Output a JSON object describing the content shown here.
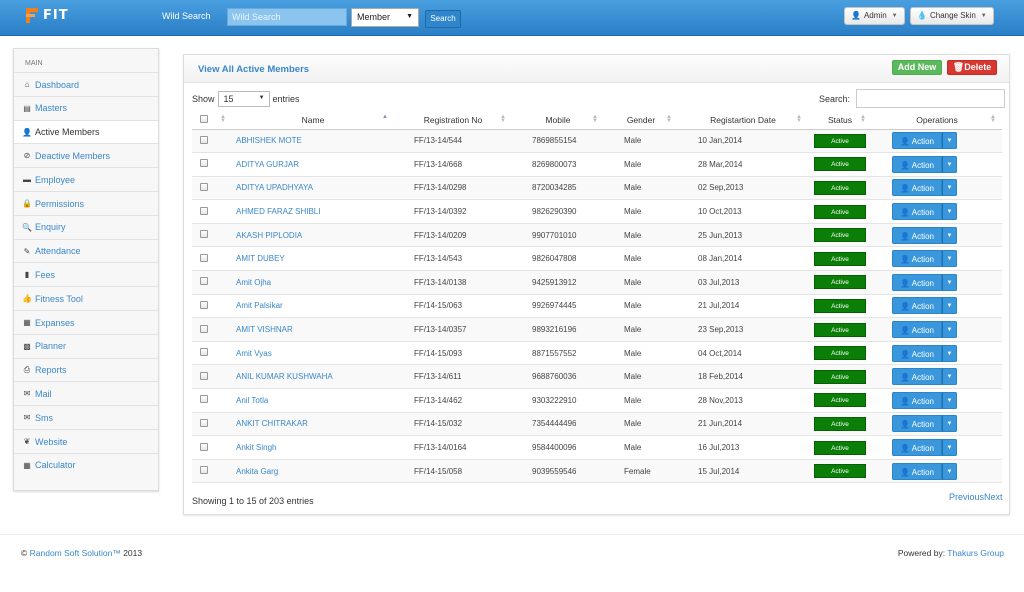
{
  "app": {
    "logo_text": "FIT"
  },
  "header": {
    "wild_search_label": "Wild Search",
    "wild_search_placeholder": "Wild Search",
    "member_select": "Member",
    "search_button": "Search",
    "admin_button": "Admin",
    "skin_button": "Change Skin"
  },
  "sidebar": {
    "section_label": "MAIN",
    "items": [
      {
        "label": "Dashboard",
        "icon": "home-icon",
        "glyph": "⌂"
      },
      {
        "label": "Masters",
        "icon": "list-icon",
        "glyph": "▤"
      },
      {
        "label": "Active Members",
        "icon": "user-icon",
        "glyph": "👤"
      },
      {
        "label": "Deactive Members",
        "icon": "user-ban-icon",
        "glyph": "⊘"
      },
      {
        "label": "Employee",
        "icon": "briefcase-icon",
        "glyph": "▬"
      },
      {
        "label": "Permissions",
        "icon": "lock-icon",
        "glyph": "🔒"
      },
      {
        "label": "Enquiry",
        "icon": "search-icon",
        "glyph": "🔍"
      },
      {
        "label": "Attendance",
        "icon": "tag-icon",
        "glyph": "✎"
      },
      {
        "label": "Fees",
        "icon": "file-icon",
        "glyph": "▮"
      },
      {
        "label": "Fitness Tool",
        "icon": "thumbs-up-icon",
        "glyph": "👍"
      },
      {
        "label": "Expanses",
        "icon": "grid-icon",
        "glyph": "▦"
      },
      {
        "label": "Planner",
        "icon": "calendar-icon",
        "glyph": "▩"
      },
      {
        "label": "Reports",
        "icon": "print-icon",
        "glyph": "⎙"
      },
      {
        "label": "Mail",
        "icon": "envelope-icon",
        "glyph": "✉"
      },
      {
        "label": "Sms",
        "icon": "envelope-icon",
        "glyph": "✉"
      },
      {
        "label": "Website",
        "icon": "leaf-icon",
        "glyph": "❦"
      },
      {
        "label": "Calculator",
        "icon": "calculator-icon",
        "glyph": "▦"
      }
    ]
  },
  "panel": {
    "title": "View All Active Members",
    "add_button": "Add New",
    "delete_button": "Delete",
    "show_label": "Show",
    "page_length": "15",
    "entries_label": "entries",
    "search_label": "Search:",
    "columns": [
      "Name",
      "Registration No",
      "Mobile",
      "Gender",
      "Registartion Date",
      "Status",
      "Operations"
    ],
    "rows": [
      {
        "name": "ABHISHEK MOTE",
        "reg": "FF/13-14/544",
        "mobile": "7869855154",
        "gender": "Male",
        "date": "10 Jan,2014",
        "status": "Active",
        "action": "Action"
      },
      {
        "name": "ADITYA GURJAR",
        "reg": "FF/13-14/668",
        "mobile": "8269800073",
        "gender": "Male",
        "date": "28 Mar,2014",
        "status": "Active",
        "action": "Action"
      },
      {
        "name": "ADITYA UPADHYAYA",
        "reg": "FF/13-14/0298",
        "mobile": "8720034285",
        "gender": "Male",
        "date": "02 Sep,2013",
        "status": "Active",
        "action": "Action"
      },
      {
        "name": "AHMED FARAZ SHIBLI",
        "reg": "FF/13-14/0392",
        "mobile": "9826290390",
        "gender": "Male",
        "date": "10 Oct,2013",
        "status": "Active",
        "action": "Action"
      },
      {
        "name": "AKASH PIPLODIA",
        "reg": "FF/13-14/0209",
        "mobile": "9907701010",
        "gender": "Male",
        "date": "25 Jun,2013",
        "status": "Active",
        "action": "Action"
      },
      {
        "name": "AMIT DUBEY",
        "reg": "FF/13-14/543",
        "mobile": "9826047808",
        "gender": "Male",
        "date": "08 Jan,2014",
        "status": "Active",
        "action": "Action"
      },
      {
        "name": "Amit Ojha",
        "reg": "FF/13-14/0138",
        "mobile": "9425913912",
        "gender": "Male",
        "date": "03 Jul,2013",
        "status": "Active",
        "action": "Action"
      },
      {
        "name": "Amit Palsikar",
        "reg": "FF/14-15/063",
        "mobile": "9926974445",
        "gender": "Male",
        "date": "21 Jul,2014",
        "status": "Active",
        "action": "Action"
      },
      {
        "name": "AMIT VISHNAR",
        "reg": "FF/13-14/0357",
        "mobile": "9893216196",
        "gender": "Male",
        "date": "23 Sep,2013",
        "status": "Active",
        "action": "Action"
      },
      {
        "name": "Amit Vyas",
        "reg": "FF/14-15/093",
        "mobile": "8871557552",
        "gender": "Male",
        "date": "04 Oct,2014",
        "status": "Active",
        "action": "Action"
      },
      {
        "name": "ANIL KUMAR KUSHWAHA",
        "reg": "FF/13-14/611",
        "mobile": "9688760036",
        "gender": "Male",
        "date": "18 Feb,2014",
        "status": "Active",
        "action": "Action"
      },
      {
        "name": "Anil Totla",
        "reg": "FF/13-14/462",
        "mobile": "9303222910",
        "gender": "Male",
        "date": "28 Nov,2013",
        "status": "Active",
        "action": "Action"
      },
      {
        "name": "ANKIT CHITRAKAR",
        "reg": "FF/14-15/032",
        "mobile": "7354444496",
        "gender": "Male",
        "date": "21 Jun,2014",
        "status": "Active",
        "action": "Action"
      },
      {
        "name": "Ankit Singh",
        "reg": "FF/13-14/0164",
        "mobile": "9584400096",
        "gender": "Male",
        "date": "16 Jul,2013",
        "status": "Active",
        "action": "Action"
      },
      {
        "name": "Ankita Garg",
        "reg": "FF/14-15/058",
        "mobile": "9039559546",
        "gender": "Female",
        "date": "15 Jul,2014",
        "status": "Active",
        "action": "Action"
      }
    ],
    "info": "Showing 1 to 15 of 203 entries",
    "prev": "Previous",
    "next": "Next"
  },
  "footer": {
    "left_prefix": "© ",
    "left_link": "Random Soft Solution™",
    "left_suffix": " 2013",
    "right_prefix": "Powered by: ",
    "right_link": "Thakurs Group"
  },
  "colors": {
    "topbar": "#2a7fc6",
    "accent": "#3a87c8",
    "status_green": "#0a7e07",
    "add_green": "#5cb85c",
    "delete_red": "#d9362f"
  }
}
